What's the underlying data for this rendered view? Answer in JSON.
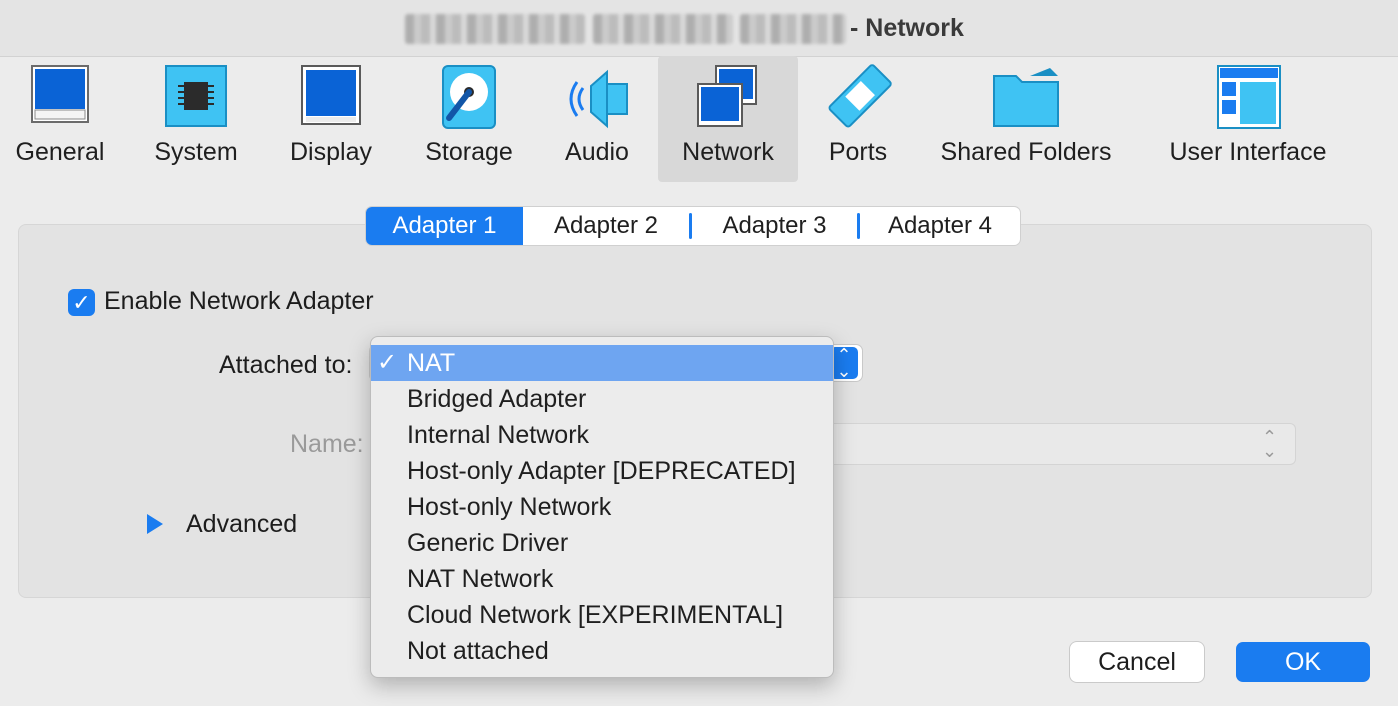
{
  "window": {
    "title_suffix": "- Network"
  },
  "toolbar": {
    "items": [
      {
        "label": "General",
        "icon": "general-icon"
      },
      {
        "label": "System",
        "icon": "chip-icon"
      },
      {
        "label": "Display",
        "icon": "monitor-icon"
      },
      {
        "label": "Storage",
        "icon": "disk-icon"
      },
      {
        "label": "Audio",
        "icon": "speaker-icon"
      },
      {
        "label": "Network",
        "icon": "network-icon",
        "selected": true
      },
      {
        "label": "Ports",
        "icon": "ports-icon"
      },
      {
        "label": "Shared Folders",
        "icon": "folder-icon"
      },
      {
        "label": "User Interface",
        "icon": "window-layout-icon"
      }
    ]
  },
  "tabs": [
    {
      "label": "Adapter 1",
      "active": true
    },
    {
      "label": "Adapter 2"
    },
    {
      "label": "Adapter 3"
    },
    {
      "label": "Adapter 4"
    }
  ],
  "enable_adapter": {
    "label": "Enable Network Adapter",
    "checked": true
  },
  "attached_to": {
    "label": "Attached to:",
    "selected": "NAT",
    "options": [
      "NAT",
      "Bridged Adapter",
      "Internal Network",
      "Host-only Adapter [DEPRECATED]",
      "Host-only Network",
      "Generic Driver",
      "NAT Network",
      "Cloud Network [EXPERIMENTAL]",
      "Not attached"
    ],
    "check_glyph": "✓"
  },
  "name_field": {
    "label": "Name:",
    "value": ""
  },
  "advanced": {
    "label": "Advanced"
  },
  "buttons": {
    "cancel": "Cancel",
    "ok": "OK"
  },
  "colors": {
    "accent": "#1a7cf0",
    "highlight": "#6ea5f1"
  }
}
